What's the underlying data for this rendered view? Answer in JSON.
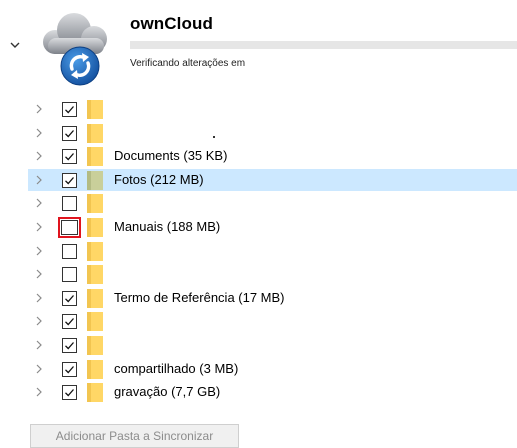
{
  "header": {
    "account_name": "ownCloud",
    "status_text": "Verificando alterações em",
    "sync_progress_percent": 0
  },
  "folders": [
    {
      "label": "",
      "checked": true,
      "highlighted": false,
      "focused": false
    },
    {
      "label": "",
      "checked": true,
      "highlighted": false,
      "focused": false
    },
    {
      "label": "Documents (35 KB)",
      "checked": true,
      "highlighted": false,
      "focused": false
    },
    {
      "label": "Fotos (212 MB)",
      "checked": true,
      "highlighted": true,
      "focused": false
    },
    {
      "label": "",
      "checked": false,
      "highlighted": false,
      "focused": false
    },
    {
      "label": "Manuais (188 MB)",
      "checked": false,
      "highlighted": false,
      "focused": true
    },
    {
      "label": "",
      "checked": false,
      "highlighted": false,
      "focused": false
    },
    {
      "label": "",
      "checked": false,
      "highlighted": false,
      "focused": false
    },
    {
      "label": "Termo de Referência (17 MB)",
      "checked": true,
      "highlighted": false,
      "focused": false
    },
    {
      "label": "",
      "checked": true,
      "highlighted": false,
      "focused": false
    },
    {
      "label": "",
      "checked": true,
      "highlighted": false,
      "focused": false
    },
    {
      "label": "compartilhado (3 MB)",
      "checked": true,
      "highlighted": false,
      "focused": false
    },
    {
      "label": "gravação (7,7 GB)",
      "checked": true,
      "highlighted": false,
      "focused": false
    }
  ],
  "footer": {
    "add_folder_label": "Adicionar Pasta a Sincronizar"
  },
  "colors": {
    "selection": "#cce8ff",
    "focus_outline": "#e0141e",
    "folder_yellow": "#ffd766",
    "logo_blue": "#1d62b6"
  },
  "icons": {
    "collapse": "chevron-down-icon",
    "logo": "owncloud-sync-logo",
    "expand": "chevron-right-icon",
    "folder": "folder-icon"
  }
}
